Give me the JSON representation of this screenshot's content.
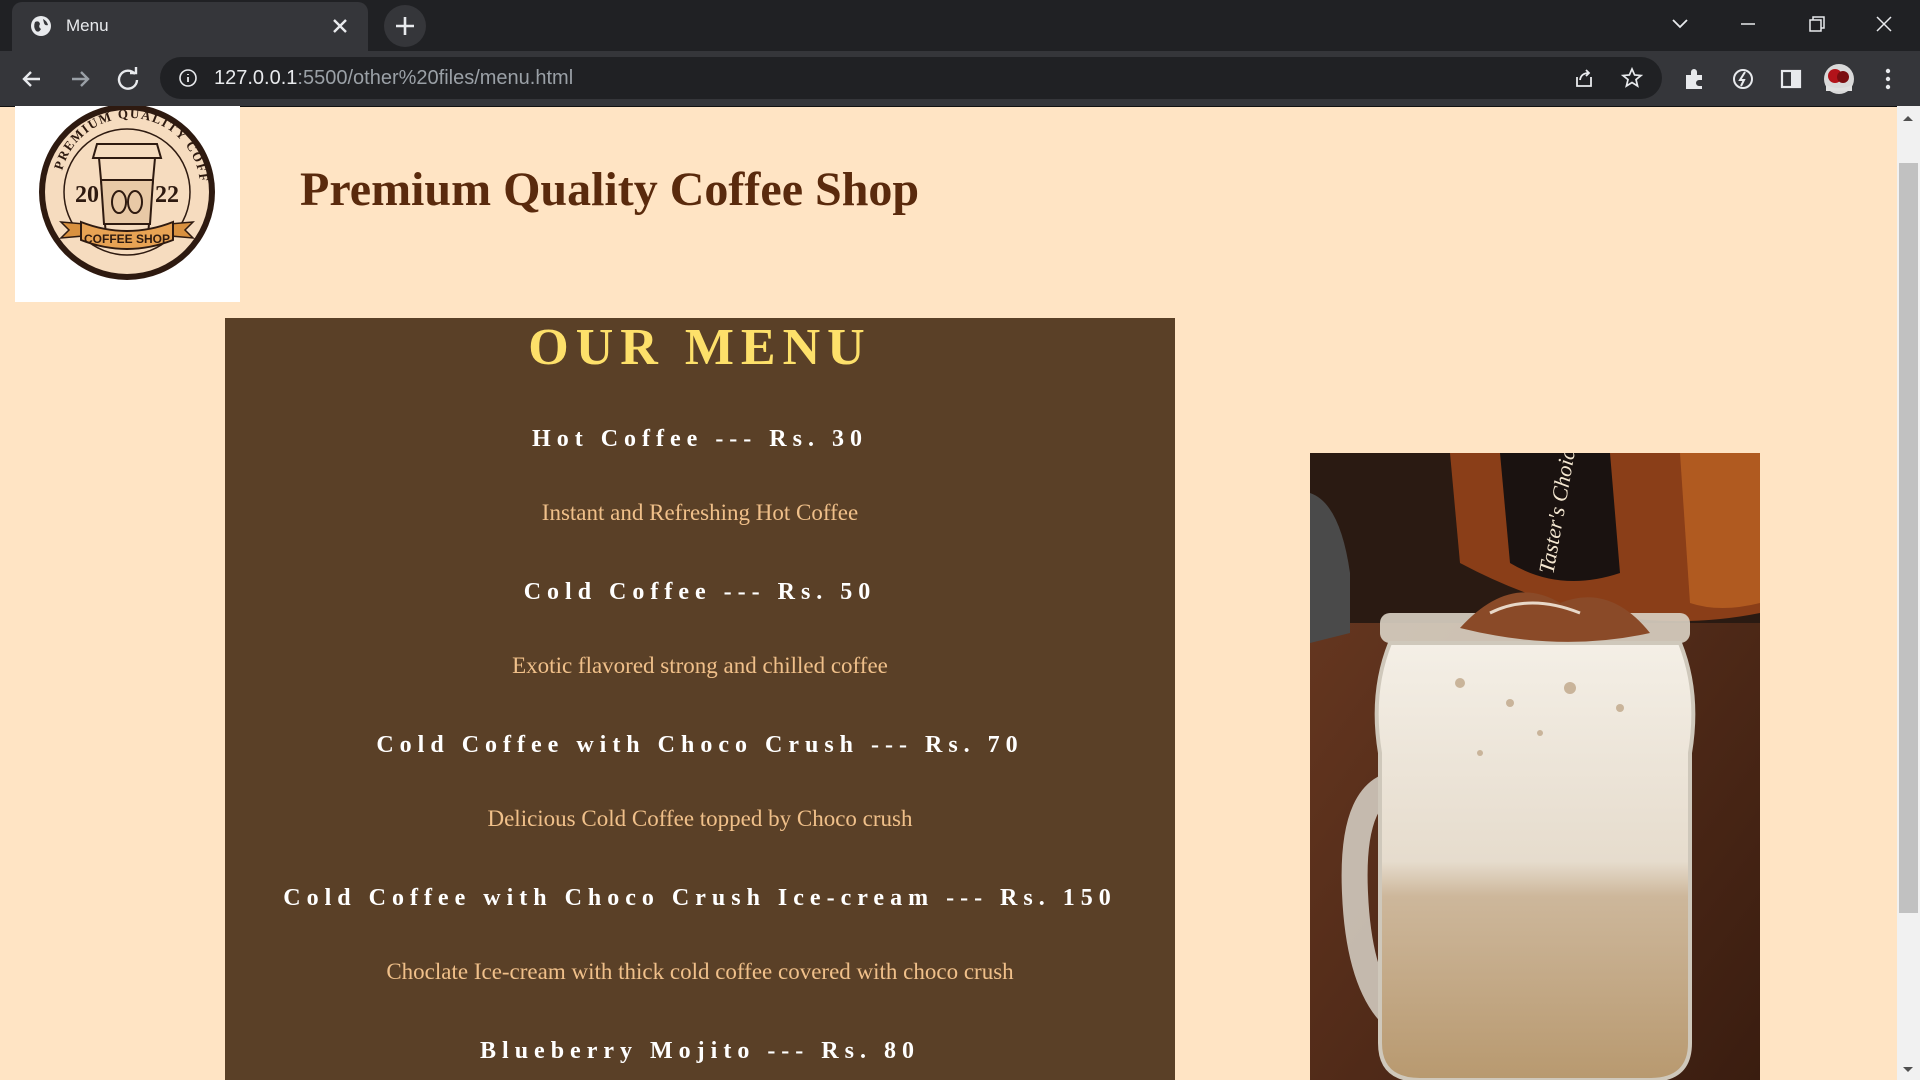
{
  "browser": {
    "tab_title": "Menu",
    "url_host": "127.0.0.1",
    "url_rest": ":5500/other%20files/menu.html"
  },
  "logo": {
    "top_text": "PREMIUM QUALITY COFFEE",
    "year_left": "20",
    "year_right": "22",
    "ribbon_text": "COFFEE SHOP"
  },
  "page": {
    "heading": "Premium Quality Coffee Shop"
  },
  "menu": {
    "title": "OUR MENU",
    "items": [
      {
        "name": "Hot Coffee --- Rs. 30",
        "desc": "Instant and Refreshing Hot Coffee"
      },
      {
        "name": "Cold Coffee --- Rs. 50",
        "desc": "Exotic flavored strong and chilled coffee"
      },
      {
        "name": "Cold Coffee with Choco Crush --- Rs. 70",
        "desc": "Delicious Cold Coffee topped by Choco crush"
      },
      {
        "name": "Cold Coffee with Choco Crush Ice-cream --- Rs. 150",
        "desc": "Choclate Ice-cream with thick cold coffee covered with choco crush"
      },
      {
        "name": "Blueberry Mojito --- Rs. 80",
        "desc": ""
      }
    ]
  },
  "photo": {
    "jar_label": "Taster's Choice"
  },
  "colors": {
    "page_bg": "#ffe4c4",
    "heading": "#5a2a0d",
    "menu_bg": "#5a4027",
    "menu_title": "#fde06a",
    "item_desc": "#f0c08a"
  }
}
